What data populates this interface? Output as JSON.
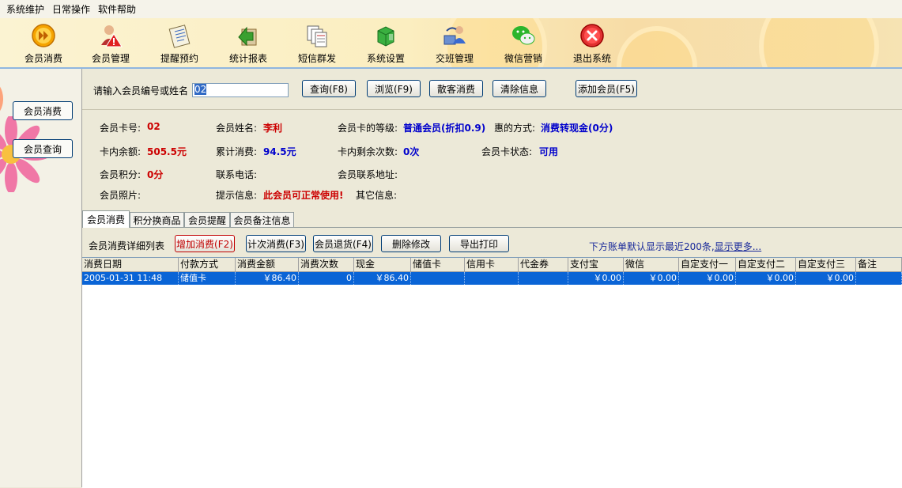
{
  "menu": [
    "系统维护",
    "日常操作",
    "软件帮助"
  ],
  "toolbar": {
    "buttons": [
      {
        "label": "会员消费",
        "icon": "forward-circle-icon"
      },
      {
        "label": "会员管理",
        "icon": "member-warning-icon"
      },
      {
        "label": "提醒预约",
        "icon": "notepad-icon"
      },
      {
        "label": "统计报表",
        "icon": "report-arrow-icon"
      },
      {
        "label": "短信群发",
        "icon": "documents-stack-icon"
      },
      {
        "label": "系统设置",
        "icon": "settings-cube-icon"
      },
      {
        "label": "交班管理",
        "icon": "handover-users-icon"
      },
      {
        "label": "微信营销",
        "icon": "wechat-icon"
      },
      {
        "label": "退出系统",
        "icon": "exit-close-icon"
      }
    ]
  },
  "sidebar": {
    "items": [
      "会员消费",
      "会员查询"
    ]
  },
  "search": {
    "label": "请输入会员编号或姓名",
    "value": "02",
    "buttons": {
      "query": "查询(F8)",
      "browse": "浏览(F9)",
      "walkin": "散客消费",
      "clear": "清除信息",
      "add": "添加会员(F5)"
    }
  },
  "member": {
    "card_no_label": "会员卡号:",
    "card_no": "02",
    "name_label": "会员姓名:",
    "name": "李利",
    "level_label": "会员卡的等级:",
    "level": "普通会员(折扣0.9)",
    "benefit_label": "惠的方式:",
    "benefit": "消费转现金(0分)",
    "balance_label": "卡内余额:",
    "balance": "505.5元",
    "total_label": "累计消费:",
    "total": "94.5元",
    "times_label": "卡内剩余次数:",
    "times": "0次",
    "status_label": "会员卡状态:",
    "status": "可用",
    "points_label": "会员积分:",
    "points": "0分",
    "phone_label": "联系电话:",
    "address_label": "会员联系地址:",
    "photo_label": "会员照片:",
    "tip_label": "提示信息:",
    "tip": "此会员可正常使用!",
    "other_label": "其它信息:"
  },
  "tabs": [
    "会员消费",
    "积分换商品",
    "会员提醒",
    "会员备注信息"
  ],
  "details": {
    "title": "会员消费详细列表",
    "buttons": {
      "add": "增加消费(F2)",
      "count": "计次消费(F3)",
      "return": "会员退货(F4)",
      "delete": "删除修改",
      "export": "导出打印"
    },
    "note": "下方账单默认显示最近200条,",
    "more": "显示更多..."
  },
  "table": {
    "columns": [
      "消费日期",
      "付款方式",
      "消费金额",
      "消费次数",
      "现金",
      "储值卡",
      "信用卡",
      "代金券",
      "支付宝",
      "微信",
      "自定支付一",
      "自定支付二",
      "自定支付三",
      "备注"
    ],
    "rows": [
      [
        "2005-01-31 11:48",
        "储值卡",
        "￥86.40",
        "0",
        "￥86.40",
        "",
        "",
        "",
        "￥0.00",
        "￥0.00",
        "￥0.00",
        "￥0.00",
        "￥0.00",
        ""
      ]
    ]
  },
  "colors": {
    "selection": "#0a64d6",
    "accent_red": "#cc0000",
    "accent_blue": "#0000cc"
  }
}
